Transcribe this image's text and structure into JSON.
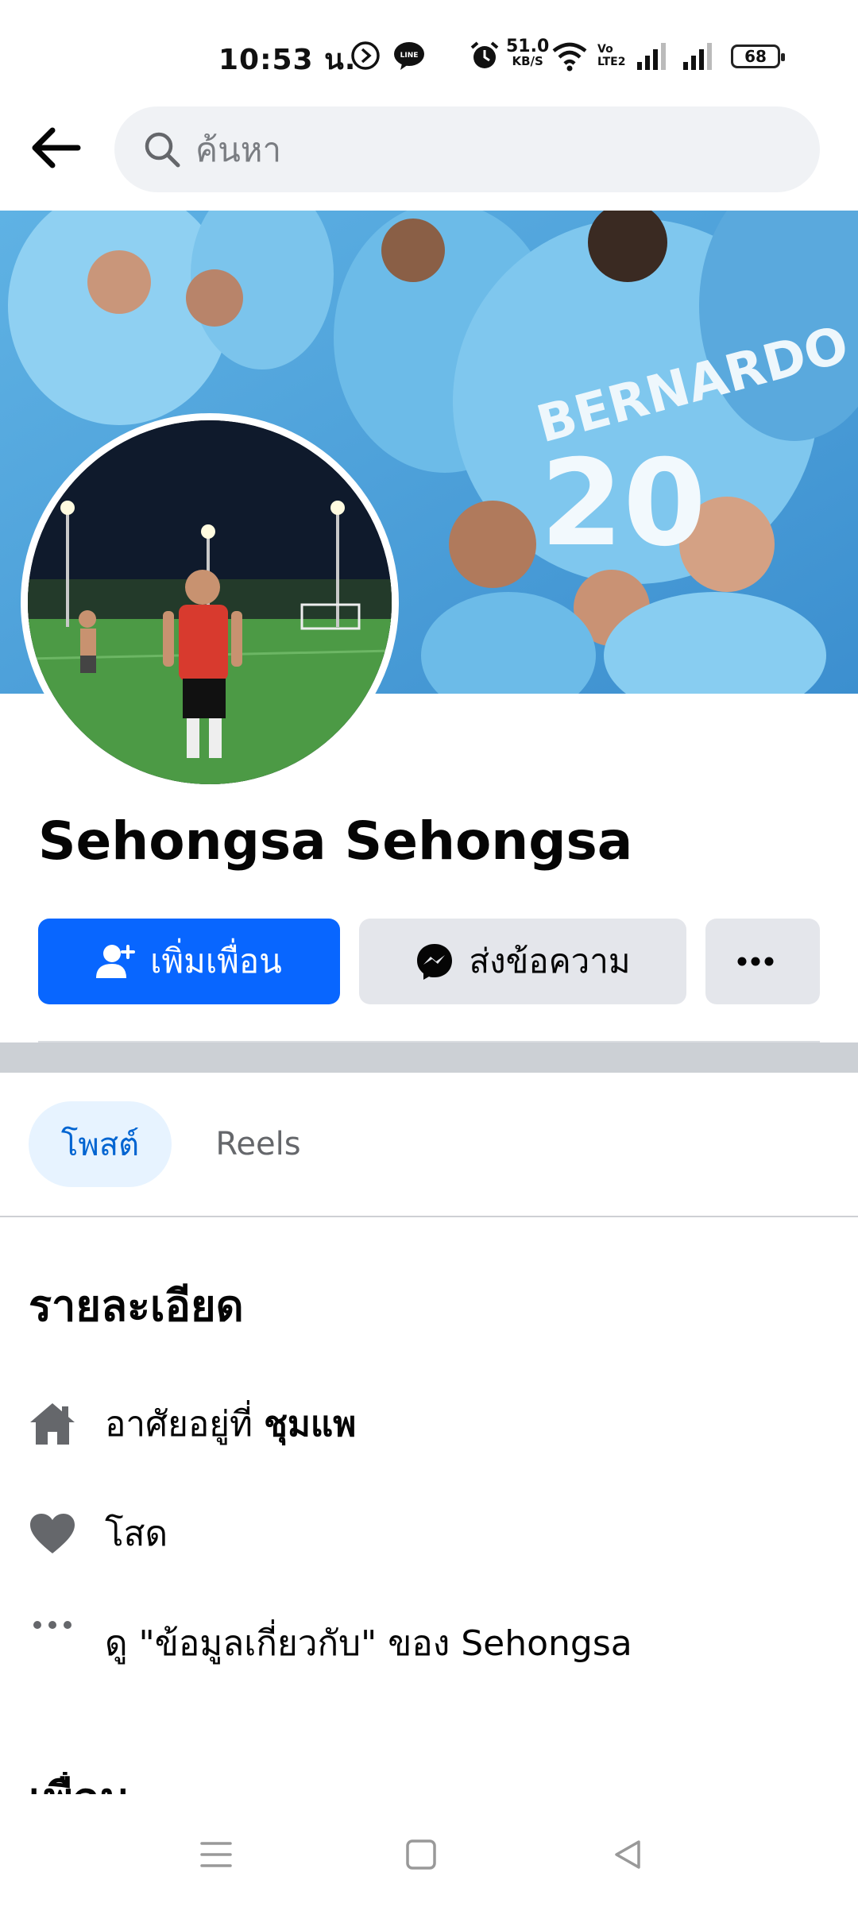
{
  "status_bar": {
    "time": "10:53 น.",
    "net_speed_value": "51.0",
    "net_speed_unit": "KB/S",
    "volte_label": "Vo LTE2",
    "battery": "68"
  },
  "search": {
    "placeholder": "ค้นหา"
  },
  "profile": {
    "name": "Sehongsa Sehongsa",
    "cover_jersey_name": "BERNARDO",
    "cover_jersey_number": "20"
  },
  "actions": {
    "add_friend_label": "เพิ่มเพื่อน",
    "message_label": "ส่งข้อความ",
    "more_label": "···"
  },
  "tabs": [
    {
      "label": "โพสต์",
      "active": true
    },
    {
      "label": "Reels",
      "active": false
    }
  ],
  "details": {
    "title": "รายละเอียด",
    "lives_in_prefix": "อาศัยอยู่ที่",
    "lives_in_place": "ชุมแพ",
    "relationship": "โสด",
    "about_link": "ดู \"ข้อมูลเกี่ยวกับ\" ของ Sehongsa"
  },
  "friends_section_title": "เพื่อน",
  "colors": {
    "primary_blue": "#0866ff",
    "secondary_button": "#e4e6eb",
    "search_bg": "#f0f2f5",
    "active_tab_bg": "#e7f3ff",
    "active_tab_text": "#0064d1"
  }
}
